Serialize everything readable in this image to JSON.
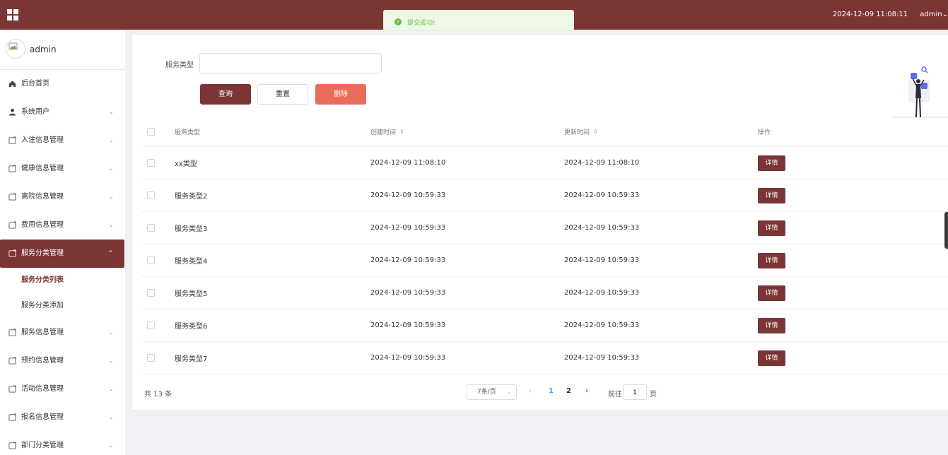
{
  "header": {
    "datetime": "2024-12-09 11:08:11",
    "user": "admin",
    "user_caret": "⌄",
    "bg_color": "#7b3535"
  },
  "toast": {
    "message": "提交成功!",
    "icon": "check-circle-icon"
  },
  "sidebar": {
    "username": "admin",
    "items": [
      {
        "label": "后台首页",
        "icon": "home-icon",
        "chevron": ""
      },
      {
        "label": "系统用户",
        "icon": "user-icon",
        "chevron": "⌄"
      },
      {
        "label": "入住信息管理",
        "icon": "folder-icon",
        "chevron": "⌄"
      },
      {
        "label": "健康信息管理",
        "icon": "folder-icon",
        "chevron": "⌄"
      },
      {
        "label": "离院信息管理",
        "icon": "folder-icon",
        "chevron": "⌄"
      },
      {
        "label": "费用信息管理",
        "icon": "folder-icon",
        "chevron": "⌄"
      },
      {
        "label": "服务分类管理",
        "icon": "folder-icon",
        "chevron": "⌃"
      },
      {
        "label": "服务信息管理",
        "icon": "folder-icon",
        "chevron": "⌄"
      },
      {
        "label": "预约信息管理",
        "icon": "folder-icon",
        "chevron": "⌄"
      },
      {
        "label": "活动信息管理",
        "icon": "folder-icon",
        "chevron": "⌄"
      },
      {
        "label": "报名信息管理",
        "icon": "folder-icon",
        "chevron": "⌄"
      },
      {
        "label": "部门分类管理",
        "icon": "folder-icon",
        "chevron": "⌄"
      }
    ],
    "sub_items": [
      {
        "label": "服务分类列表"
      },
      {
        "label": "服务分类添加"
      }
    ]
  },
  "search": {
    "label": "服务类型",
    "value": "",
    "placeholder": ""
  },
  "buttons": {
    "query": "查询",
    "reset": "重置",
    "delete": "删除"
  },
  "table": {
    "headers": {
      "type": "服务类型",
      "created": "创建时间",
      "updated": "更新时间",
      "operation": "操作",
      "sort_icon": "⇕"
    },
    "detail_label": "详情",
    "rows": [
      {
        "type": "xx类型",
        "created": "2024-12-09 11:08:10",
        "updated": "2024-12-09 11:08:10"
      },
      {
        "type": "服务类型2",
        "created": "2024-12-09 10:59:33",
        "updated": "2024-12-09 10:59:33"
      },
      {
        "type": "服务类型3",
        "created": "2024-12-09 10:59:33",
        "updated": "2024-12-09 10:59:33"
      },
      {
        "type": "服务类型4",
        "created": "2024-12-09 10:59:33",
        "updated": "2024-12-09 10:59:33"
      },
      {
        "type": "服务类型5",
        "created": "2024-12-09 10:59:33",
        "updated": "2024-12-09 10:59:33"
      },
      {
        "type": "服务类型6",
        "created": "2024-12-09 10:59:33",
        "updated": "2024-12-09 10:59:33"
      },
      {
        "type": "服务类型7",
        "created": "2024-12-09 10:59:33",
        "updated": "2024-12-09 10:59:33"
      }
    ]
  },
  "pagination": {
    "total": "共 13 条",
    "page_size": "7条/页",
    "prev": "‹",
    "pages": [
      "1",
      "2"
    ],
    "next": "›",
    "goto_label": "前往",
    "goto_value": "1",
    "goto_unit": "页"
  }
}
